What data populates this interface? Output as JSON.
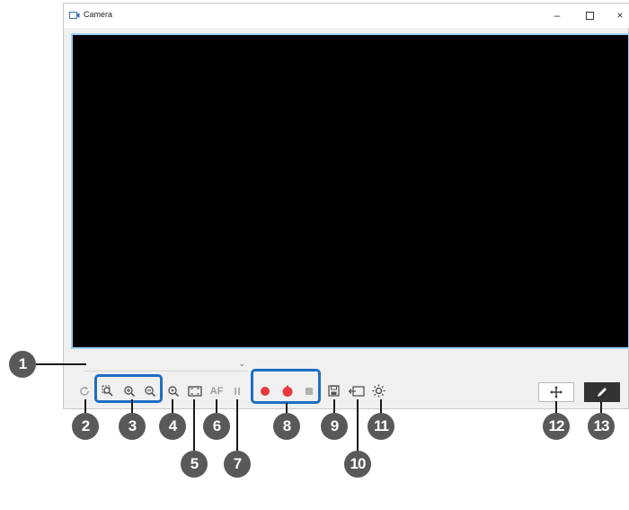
{
  "window": {
    "title": "Camera",
    "controls": {
      "minimize": "–",
      "close": "×"
    }
  },
  "toolbar": {
    "af_label": "AF",
    "icons": [
      "rotate-icon",
      "zoom-fit-icon",
      "zoom-in-icon",
      "zoom-out-icon",
      "zoom-reset-icon",
      "fit-screen-icon",
      "autofocus-icon",
      "pause-icon",
      "record-icon",
      "record-pause-icon",
      "stop-icon",
      "save-icon",
      "image-import-icon",
      "brightness-icon"
    ]
  },
  "right_buttons": [
    "move-icon",
    "pen-icon"
  ],
  "callouts": [
    "1",
    "2",
    "3",
    "4",
    "5",
    "6",
    "7",
    "8",
    "9",
    "10",
    "11",
    "12",
    "13"
  ],
  "colors": {
    "preview_bg": "#000000",
    "preview_border": "#9ad0f5",
    "highlight_box": "#1e6ec4",
    "record_red": "#e8383d",
    "callout_badge": "#595959"
  }
}
